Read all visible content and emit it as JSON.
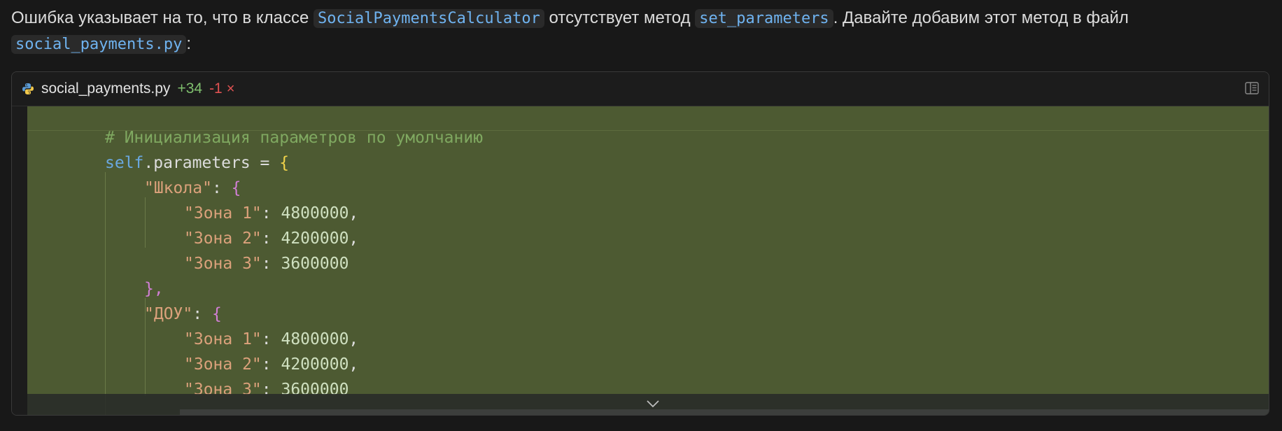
{
  "message": {
    "text_before": "Ошибка указывает на то, что в классе ",
    "class_name": "SocialPaymentsCalculator",
    "text_middle": " отсутствует метод ",
    "method_name": "set_parameters",
    "text_after": ". Давайте добавим этот метод в файл ",
    "file_name": "social_payments.py",
    "text_end": ":"
  },
  "code_card": {
    "filename": "social_payments.py",
    "lines_added": "+34",
    "lines_removed": "-1",
    "close_symbol": "×",
    "file_icon": "python-icon",
    "layout_icon": "split-view-icon",
    "expand_icon": "chevron-down-icon",
    "colors": {
      "diff_added_bg": "#4d5a32",
      "added": "#7fbf6e",
      "removed": "#e05252"
    }
  },
  "code": {
    "comment": "# Инициализация параметров по умолчанию",
    "self_kw": "self",
    "attr": ".parameters = ",
    "brace_open": "{",
    "key_school": "\"Школа\"",
    "key_dou": "\"ДОУ\"",
    "zone1": "\"Зона 1\"",
    "zone2": "\"Зона 2\"",
    "zone3": "\"Зона 3\"",
    "val1": "4800000",
    "val2": "4200000",
    "val3": "3600000",
    "colon": ": ",
    "comma": ",",
    "close_brace_comma": "},"
  }
}
